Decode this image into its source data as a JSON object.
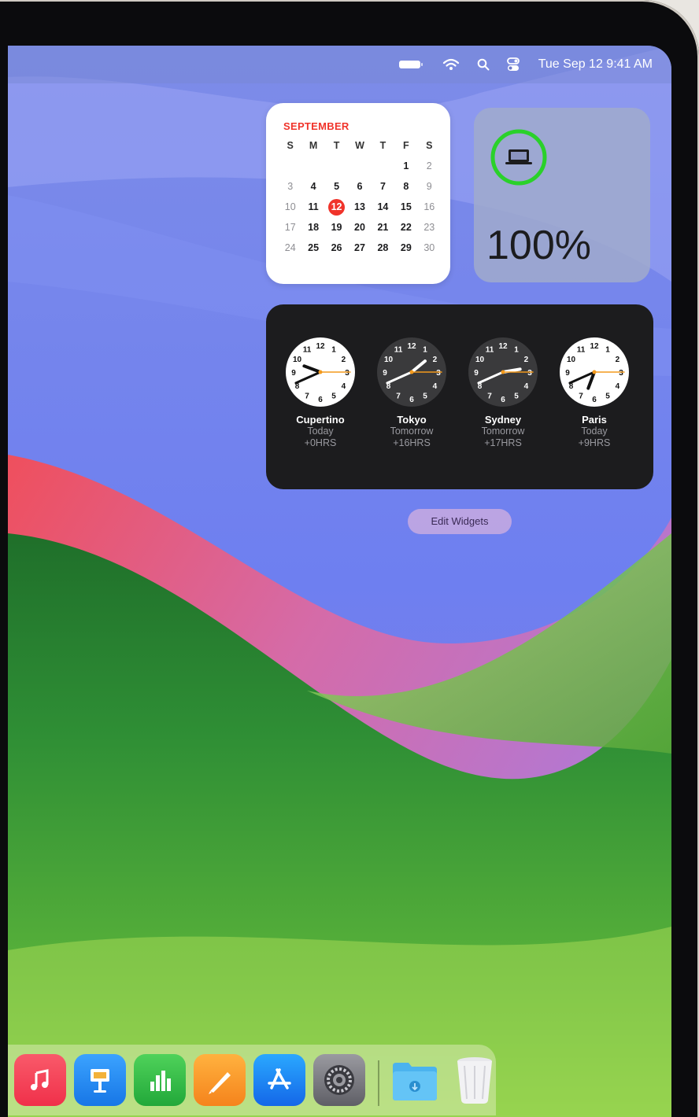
{
  "menubar": {
    "icons": [
      "battery-icon",
      "wifi-icon",
      "spotlight-search-icon",
      "control-center-icon"
    ],
    "datetime": "Tue Sep 12  9:41 AM"
  },
  "calendar": {
    "month": "SEPTEMBER",
    "weekdays": [
      "S",
      "M",
      "T",
      "W",
      "T",
      "F",
      "S"
    ],
    "rows": [
      [
        "",
        "",
        "",
        "",
        "",
        "1",
        "2"
      ],
      [
        "3",
        "4",
        "5",
        "6",
        "7",
        "8",
        "9"
      ],
      [
        "10",
        "11",
        "12",
        "13",
        "14",
        "15",
        "16"
      ],
      [
        "17",
        "18",
        "19",
        "20",
        "21",
        "22",
        "23"
      ],
      [
        "24",
        "25",
        "26",
        "27",
        "28",
        "29",
        "30"
      ]
    ],
    "today": "12",
    "accent": "#f0332a"
  },
  "battery": {
    "percent": "100%",
    "level": 1.0,
    "ring_color": "#2ad12a",
    "device_icon": "laptop-icon"
  },
  "world_clock": {
    "cities": [
      {
        "city": "Cupertino",
        "day": "Today",
        "offset": "+0HRS",
        "face": "light",
        "time": "9:41"
      },
      {
        "city": "Tokyo",
        "day": "Tomorrow",
        "offset": "+16HRS",
        "face": "dark",
        "time": "1:41"
      },
      {
        "city": "Sydney",
        "day": "Tomorrow",
        "offset": "+17HRS",
        "face": "dark",
        "time": "2:41"
      },
      {
        "city": "Paris",
        "day": "Today",
        "offset": "+9HRS",
        "face": "light",
        "time": "6:41"
      }
    ]
  },
  "edit_widgets_label": "Edit Widgets",
  "dock": {
    "apps": [
      "music-icon",
      "keynote-icon",
      "numbers-icon",
      "pages-icon",
      "app-store-icon",
      "system-settings-icon",
      "downloads-folder-icon",
      "trash-icon"
    ]
  }
}
